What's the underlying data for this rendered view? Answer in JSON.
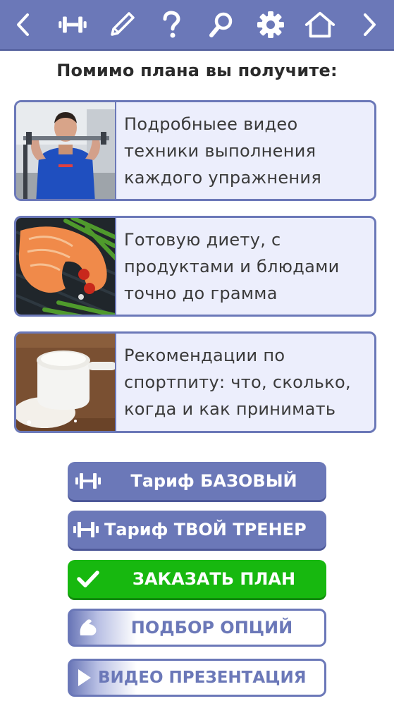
{
  "toolbar": {
    "icons": [
      "chevron-left-icon",
      "dumbbell-icon",
      "pencil-icon",
      "help-icon",
      "search-icon",
      "gear-icon",
      "home-icon",
      "chevron-right-icon"
    ],
    "color": "#6b78b8"
  },
  "heading": "Помимо плана вы получите:",
  "features": [
    {
      "image": "trainer-with-barbell-photo",
      "lines": [
        "Подробныее видео",
        "техники выполнения",
        "каждого упражнения"
      ]
    },
    {
      "image": "salmon-asparagus-photo",
      "lines": [
        "Готовую диету, с",
        "продуктами и блюдами",
        "точно до грамма"
      ]
    },
    {
      "image": "protein-powder-scoop-photo",
      "lines": [
        "Рекомендации по",
        "спортпиту: что, сколько,",
        "когда и как принимать"
      ]
    }
  ],
  "buttons": {
    "basic": "Тариф БАЗОВЫЙ",
    "trainer": "Тариф ТВОЙ ТРЕНЕР",
    "order": "ЗАКАЗАТЬ ПЛАН",
    "options": "ПОДБОР ОПЦИЙ",
    "video": "ВИДЕО ПРЕЗЕНТАЦИЯ"
  },
  "colors": {
    "accent": "#6b78b8",
    "card_bg": "#eceefc",
    "order_green": "#17b80f"
  }
}
